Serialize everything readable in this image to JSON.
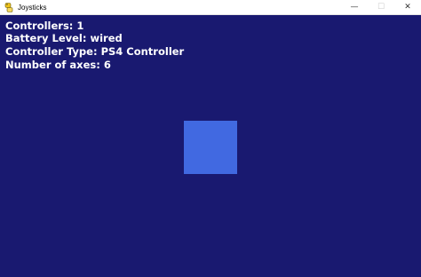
{
  "window": {
    "title": "Joysticks",
    "icon": "python-snake-icon",
    "controls": {
      "minimize": "—",
      "maximize": "☐",
      "close": "✕"
    }
  },
  "info": {
    "controllers": "Controllers: 1",
    "battery": "Battery Level: wired",
    "type": "Controller Type: PS4 Controller",
    "axes": "Number of axes: 6"
  },
  "colors": {
    "background": "#191970",
    "square": "#4169e1",
    "text": "#ffffff"
  }
}
